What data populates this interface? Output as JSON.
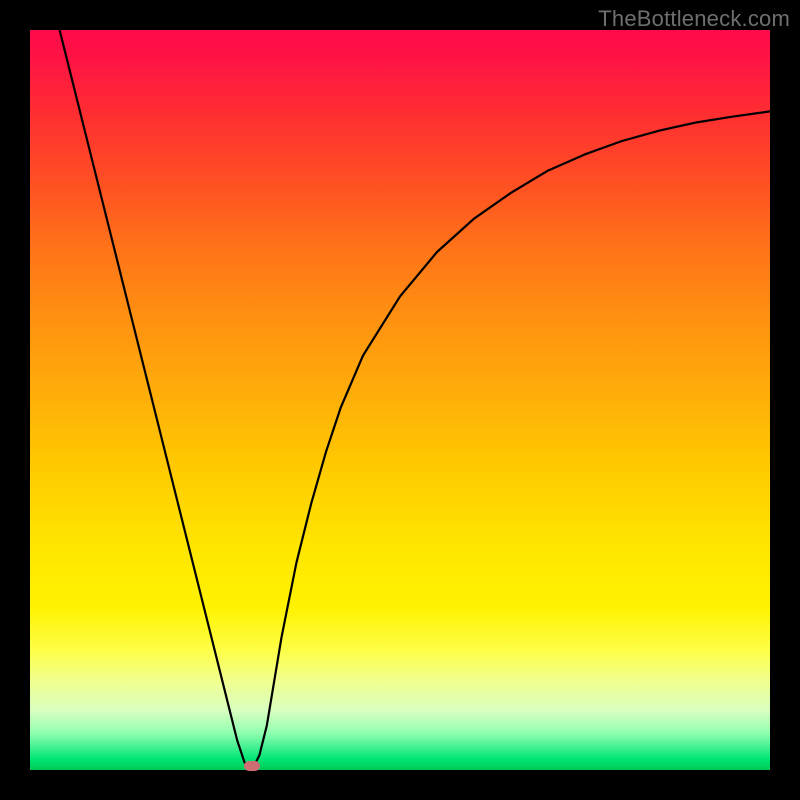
{
  "watermark": "TheBottleneck.com",
  "chart_data": {
    "type": "line",
    "title": "",
    "xlabel": "",
    "ylabel": "",
    "xlim": [
      0,
      100
    ],
    "ylim": [
      0,
      100
    ],
    "series": [
      {
        "name": "bottleneck-curve",
        "x": [
          4,
          6,
          8,
          10,
          12,
          14,
          16,
          18,
          20,
          22,
          24,
          26,
          27,
          28,
          29,
          30,
          31,
          32,
          33,
          34,
          36,
          38,
          40,
          42,
          45,
          50,
          55,
          60,
          65,
          70,
          75,
          80,
          85,
          90,
          95,
          100
        ],
        "values": [
          100,
          92,
          84,
          76,
          68,
          60,
          52,
          44,
          36,
          28,
          20,
          12,
          8,
          4,
          1,
          0,
          2,
          6,
          12,
          18,
          28,
          36,
          43,
          49,
          56,
          64,
          70,
          74.5,
          78,
          81,
          83.2,
          85,
          86.4,
          87.5,
          88.3,
          89
        ]
      }
    ],
    "marker": {
      "x": 30,
      "y": 0.5
    },
    "gradient_stops": [
      {
        "pos": 0,
        "color": "#ff0a4a"
      },
      {
        "pos": 50,
        "color": "#ffcc00"
      },
      {
        "pos": 100,
        "color": "#00c853"
      }
    ]
  }
}
